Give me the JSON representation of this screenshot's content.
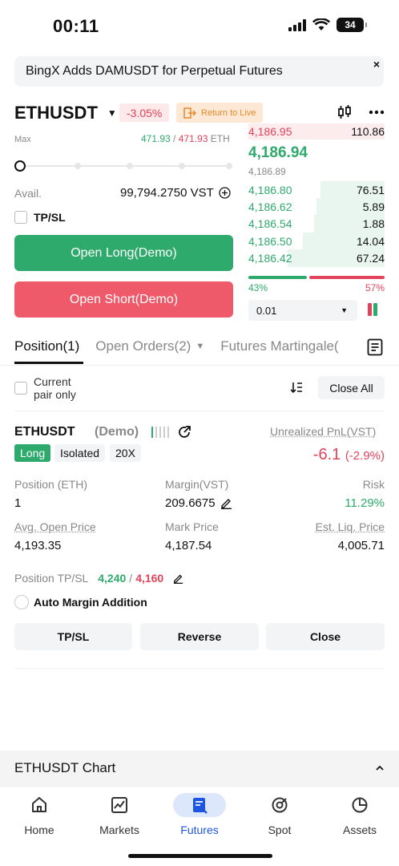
{
  "status_bar": {
    "time": "00:11",
    "battery": "34"
  },
  "banner": {
    "text": "BingX Adds DAMUSDT  for Perpetual Futures",
    "close": "×"
  },
  "header": {
    "pair": "ETHUSDT",
    "change": "-3.05%",
    "return_live": "Return to Live"
  },
  "form": {
    "max_label": "Max",
    "max_long": "471.93",
    "max_sep": " / ",
    "max_short": "471.93",
    "max_unit": " ETH",
    "avail_label": "Avail.",
    "avail_value": "99,794.2750 VST",
    "tpsl_label": "TP/SL",
    "open_long": "Open Long(Demo)",
    "open_short": "Open Short(Demo)"
  },
  "orderbook": {
    "ask_top": {
      "price": "4,186.95",
      "qty": "110.86"
    },
    "mid_price": "4,186.94",
    "mark_price": "4,186.89",
    "bids": [
      {
        "price": "4,186.80",
        "qty": "76.51",
        "depth": 0.47
      },
      {
        "price": "4,186.62",
        "qty": "5.89",
        "depth": 0.5
      },
      {
        "price": "4,186.54",
        "qty": "1.88",
        "depth": 0.52
      },
      {
        "price": "4,186.50",
        "qty": "14.04",
        "depth": 0.6
      },
      {
        "price": "4,186.42",
        "qty": "67.24",
        "depth": 0.71
      }
    ],
    "buy_pct": "43%",
    "sell_pct": "57%",
    "buy_ratio": 0.43,
    "precision": "0.01"
  },
  "tabs": [
    {
      "label": "Position(1)"
    },
    {
      "label": "Open Orders(2)"
    },
    {
      "label": "Futures Martingale("
    }
  ],
  "filter": {
    "current_pair": "Current\npair only",
    "close_all": "Close All"
  },
  "position": {
    "pair": "ETHUSDT",
    "demo": "(Demo)",
    "side": "Long",
    "margin_mode": "Isolated",
    "leverage": "20X",
    "upnl_label": "Unrealized PnL(VST)",
    "upnl": "-6.1",
    "upnl_pct": "(-2.9%)",
    "size_label": "Position (ETH)",
    "size": "1",
    "margin_label": "Margin(VST)",
    "margin": "209.6675",
    "risk_label": "Risk",
    "risk": "11.29%",
    "avg_label": "Avg. Open Price",
    "avg": "4,193.35",
    "mark_label": "Mark Price",
    "mark": "4,187.54",
    "liq_label": "Est. Liq. Price",
    "liq": "4,005.71",
    "tpsl_label": "Position TP/SL",
    "tp": "4,240",
    "tpsl_sep": " / ",
    "sl": "4,160",
    "auto_margin": "Auto Margin Addition",
    "btn_tpsl": "TP/SL",
    "btn_reverse": "Reverse",
    "btn_close": "Close"
  },
  "chart_bar": {
    "title": "ETHUSDT Chart"
  },
  "nav": [
    {
      "label": "Home"
    },
    {
      "label": "Markets"
    },
    {
      "label": "Futures"
    },
    {
      "label": "Spot"
    },
    {
      "label": "Assets"
    }
  ],
  "colors": {
    "green": "#2eaa6c",
    "red": "#e2435a",
    "accent": "#1f56e0"
  }
}
